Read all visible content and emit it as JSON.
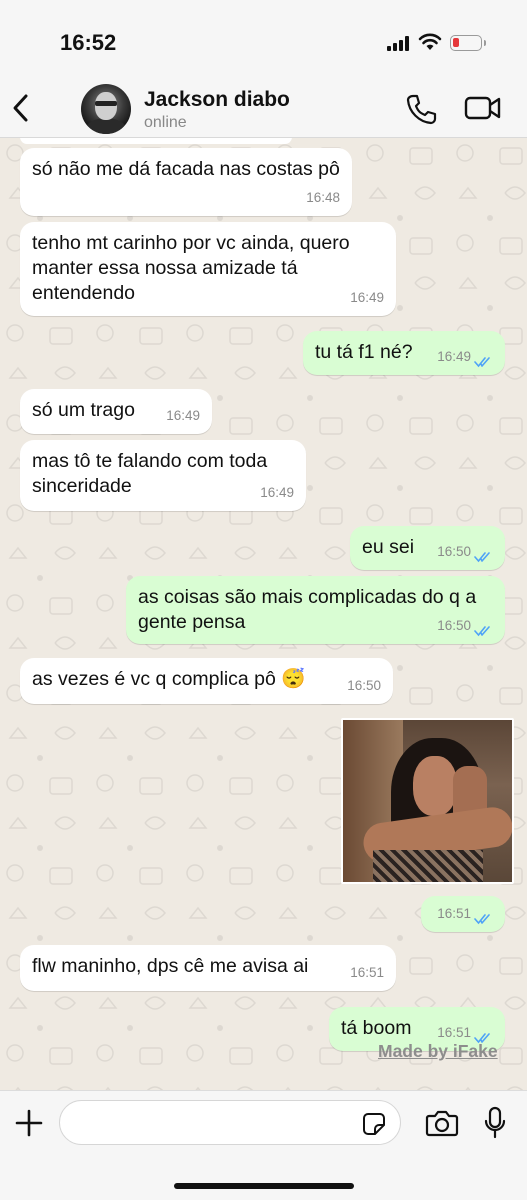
{
  "status_bar": {
    "time": "16:52"
  },
  "header": {
    "contact_name": "Jackson diabo",
    "contact_status": "online"
  },
  "messages": [
    {
      "dir": "in",
      "text": "só não me dá facada nas costas pô",
      "time": "16:48"
    },
    {
      "dir": "in",
      "text": "tenho mt carinho por vc ainda, quero manter essa nossa amizade tá entendendo",
      "time": "16:49"
    },
    {
      "dir": "out",
      "text": "tu tá f1 né?",
      "time": "16:49",
      "read": true
    },
    {
      "dir": "in",
      "text": "só um trago",
      "time": "16:49"
    },
    {
      "dir": "in",
      "text": "mas tô te falando com toda sinceridade",
      "time": "16:49"
    },
    {
      "dir": "out",
      "text": "eu sei",
      "time": "16:50",
      "read": true
    },
    {
      "dir": "out",
      "text": "as coisas são mais complicadas do q a gente pensa",
      "time": "16:50",
      "read": true
    },
    {
      "dir": "in",
      "text": "as vezes é vc q complica pô 😴",
      "time": "16:50"
    },
    {
      "dir": "out",
      "type": "image",
      "time": "16:51",
      "read": true
    },
    {
      "dir": "in",
      "text": "flw maninho, dps cê me avisa ai",
      "time": "16:51"
    },
    {
      "dir": "out",
      "text": "tá boom",
      "time": "16:51",
      "read": true
    }
  ],
  "watermark": "Made by iFake",
  "icons": {
    "back": "chevron-left-icon",
    "call": "phone-icon",
    "video": "video-camera-icon",
    "attach": "plus-icon",
    "sticker": "sticker-icon",
    "camera": "camera-icon",
    "mic": "microphone-icon"
  },
  "colors": {
    "incoming": "#ffffff",
    "outgoing": "#d9fdd3",
    "read_ticks": "#4fa3f7",
    "background": "#efeae2"
  }
}
